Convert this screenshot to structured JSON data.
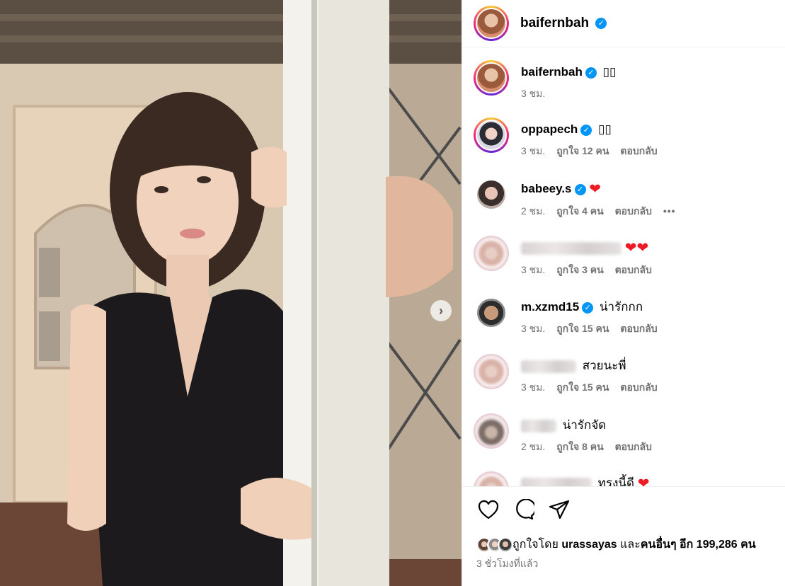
{
  "post": {
    "username": "baifernbah",
    "verified_icon": "verified-badge-icon",
    "next_icon": "chevron-right-icon"
  },
  "comments": [
    {
      "user": "baifernbah",
      "text": "▯▯",
      "time": "3 ชม.",
      "likes": "",
      "reply": ""
    },
    {
      "user": "oppapech",
      "text": "▯▯",
      "time": "3 ชม.",
      "likes": "ถูกใจ 12 คน",
      "reply": "ตอบกลับ"
    },
    {
      "user": "babeey.s",
      "text": "",
      "time": "2 ชม.",
      "likes": "ถูกใจ 4 คน",
      "reply": "ตอบกลับ",
      "more": "•••"
    },
    {
      "user": "",
      "text": "",
      "time": "3 ชม.",
      "likes": "ถูกใจ 3 คน",
      "reply": "ตอบกลับ"
    },
    {
      "user": "m.xzmd15",
      "text": "น่ารักกก",
      "time": "3 ชม.",
      "likes": "ถูกใจ 15 คน",
      "reply": "ตอบกลับ"
    },
    {
      "user": "",
      "text": "สวยนะพี่",
      "time": "3 ชม.",
      "likes": "ถูกใจ 15 คน",
      "reply": "ตอบกลับ"
    },
    {
      "user": "",
      "text": "น่ารักจัด",
      "time": "2 ชม.",
      "likes": "ถูกใจ 8 คน",
      "reply": "ตอบกลับ"
    },
    {
      "user": "",
      "text": "ทรงนี้ดี",
      "time": "",
      "likes": "",
      "reply": ""
    }
  ],
  "footer": {
    "liked_by_prefix": "ถูกใจโดย ",
    "liked_by_user": "urassayas",
    "liked_by_and": " และ",
    "liked_by_others": "คนอื่นๆ อีก 199,286 คน",
    "time_ago": "3 ชั่วโมงที่แล้ว",
    "icons": [
      "heart-icon",
      "comment-icon",
      "share-icon"
    ]
  }
}
